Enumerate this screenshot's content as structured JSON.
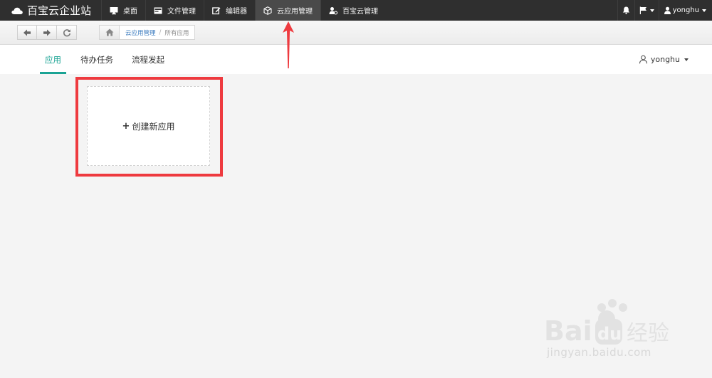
{
  "navbar": {
    "brand": "百宝云企业站",
    "items": [
      {
        "label": "桌面",
        "icon": "monitor-icon"
      },
      {
        "label": "文件管理",
        "icon": "file-manager-icon"
      },
      {
        "label": "编辑器",
        "icon": "edit-icon"
      },
      {
        "label": "云应用管理",
        "icon": "cube-icon",
        "active": true
      },
      {
        "label": "百宝云管理",
        "icon": "user-gear-icon"
      }
    ],
    "right": {
      "bell_icon": "bell-icon",
      "flag_icon": "flag-icon",
      "username": "yonghu"
    }
  },
  "toolbar": {
    "back_icon": "arrow-left-icon",
    "forward_icon": "arrow-right-icon",
    "refresh_icon": "refresh-icon",
    "home_icon": "home-icon",
    "breadcrumb": {
      "link": "云应用管理",
      "separator": "/",
      "current": "所有应用"
    }
  },
  "tabs": [
    {
      "label": "应用",
      "active": true
    },
    {
      "label": "待办任务"
    },
    {
      "label": "流程发起"
    }
  ],
  "user_menu": {
    "label": "yonghu"
  },
  "card": {
    "plus": "+",
    "label": "创建新应用"
  },
  "watermark": {
    "text": "jingyan.baidu.com",
    "brand": "Bai du 经验"
  },
  "colors": {
    "accent": "#1aa394",
    "highlight": "#ee3a3f",
    "navbar": "#2f2f2f",
    "link": "#3b7bbf"
  }
}
